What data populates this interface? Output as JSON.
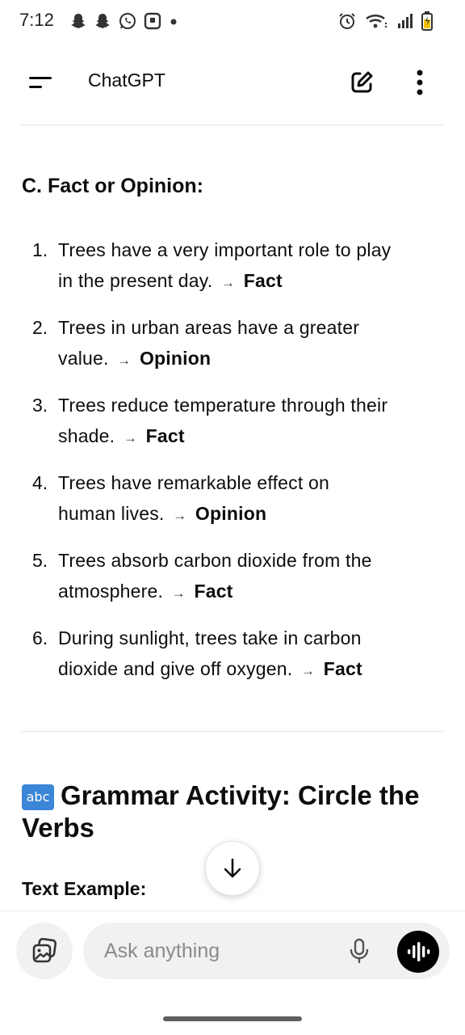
{
  "status_bar": {
    "time": "7:12",
    "icons": [
      "snapchat-icon",
      "snapchat-icon",
      "whatsapp-icon",
      "notification-icon",
      "dot-icon",
      "alarm-icon",
      "wifi-icon",
      "signal-icon",
      "battery-charging-icon"
    ]
  },
  "header": {
    "title": "ChatGPT",
    "icons": [
      "menu-icon",
      "new-chat-icon",
      "more-vertical-icon"
    ]
  },
  "content": {
    "section_title": "C. Fact or Opinion:",
    "items": [
      {
        "number": "1.",
        "line1": "Trees have a very important role to play",
        "line2": "in the present day.",
        "arrow": "→",
        "answer": "Fact"
      },
      {
        "number": "2.",
        "line1": "Trees in urban areas have a greater",
        "line2": "value.",
        "arrow": "→",
        "answer": "Opinion"
      },
      {
        "number": "3.",
        "line1": "Trees reduce temperature through their",
        "line2": "shade.",
        "arrow": "→",
        "answer": "Fact"
      },
      {
        "number": "4.",
        "line1": "Trees have remarkable effect on",
        "line2": "human lives.",
        "arrow": "→",
        "answer": "Opinion"
      },
      {
        "number": "5.",
        "line1": "Trees absorb carbon dioxide from the",
        "line2": "atmosphere.",
        "arrow": "→",
        "answer": "Fact"
      },
      {
        "number": "6.",
        "line1": "During sunlight, trees take in carbon",
        "line2": "dioxide and give off oxygen.",
        "arrow": "→",
        "answer": "Fact"
      }
    ],
    "grammar_emoji": "abc",
    "grammar_title": "Grammar Activity: Circle the Verbs",
    "text_example": "Text Example:"
  },
  "composer": {
    "placeholder": "Ask anything"
  },
  "colors": {
    "text": "#0d0d0d",
    "pill_bg": "#f1f1f1",
    "badge_blue": "#3b86d6",
    "voice_button": "#000000"
  }
}
